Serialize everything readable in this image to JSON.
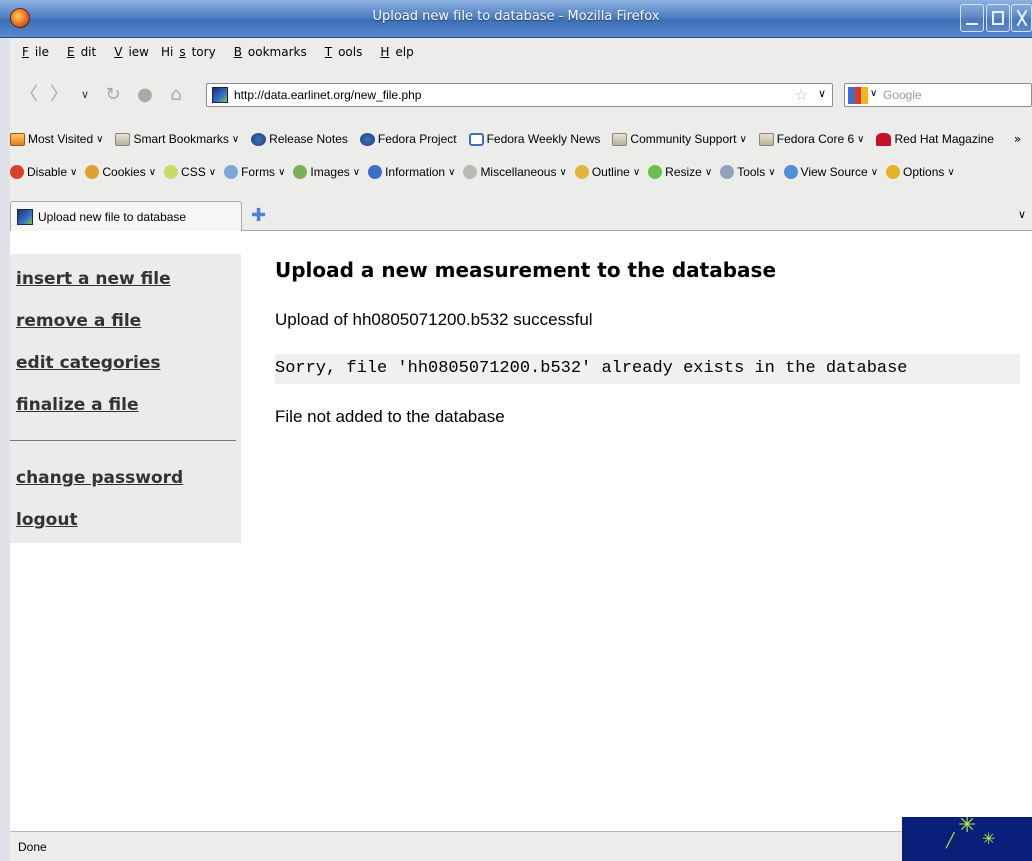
{
  "window": {
    "title": "Upload new file to database - Mozilla Firefox"
  },
  "menu": [
    "File",
    "Edit",
    "View",
    "History",
    "Bookmarks",
    "Tools",
    "Help"
  ],
  "menu_mnemonics": [
    "F",
    "E",
    "V",
    "s",
    "B",
    "T",
    "H"
  ],
  "navigation": {
    "url": "http://data.earlinet.org/new_file.php",
    "search_placeholder": "Google"
  },
  "bookmarks": [
    {
      "label": "Most Visited",
      "icon": "folder-orange",
      "menu": true
    },
    {
      "label": "Smart Bookmarks",
      "icon": "folder",
      "menu": true
    },
    {
      "label": "Release Notes",
      "icon": "fedora",
      "menu": false
    },
    {
      "label": "Fedora Project",
      "icon": "fedora",
      "menu": false
    },
    {
      "label": "Fedora Weekly News",
      "icon": "news",
      "menu": false
    },
    {
      "label": "Community Support",
      "icon": "folder",
      "menu": true
    },
    {
      "label": "Fedora Core 6",
      "icon": "folder",
      "menu": true
    },
    {
      "label": "Red Hat Magazine",
      "icon": "redhat",
      "menu": false
    }
  ],
  "bookmarks_more": "»",
  "devtools": [
    {
      "label": "Disable",
      "color": "#d9402b"
    },
    {
      "label": "Cookies",
      "color": "#e0a030"
    },
    {
      "label": "CSS",
      "color": "#c9d96a"
    },
    {
      "label": "Forms",
      "color": "#7fa6d6"
    },
    {
      "label": "Images",
      "color": "#7fae5a"
    },
    {
      "label": "Information",
      "color": "#3d6fc6"
    },
    {
      "label": "Miscellaneous",
      "color": "#b9b9b5"
    },
    {
      "label": "Outline",
      "color": "#e2b43a"
    },
    {
      "label": "Resize",
      "color": "#6bbf4a"
    },
    {
      "label": "Tools",
      "color": "#8fa3bf"
    },
    {
      "label": "View Source",
      "color": "#4f8fd6"
    },
    {
      "label": "Options",
      "color": "#e5b02a"
    }
  ],
  "tab": {
    "label": "Upload new file to database"
  },
  "sidebar": {
    "items": [
      "insert a new file",
      "remove a file",
      "edit categories",
      "finalize a file"
    ],
    "account_items": [
      "change password",
      "logout"
    ]
  },
  "main": {
    "heading": "Upload a new measurement to the database",
    "success_message": "Upload of hh0805071200.b532 successful",
    "error_message": "Sorry, file 'hh0805071200.b532' already exists in the database",
    "result_message": "File not added to the database"
  },
  "status": {
    "text": "Done"
  }
}
